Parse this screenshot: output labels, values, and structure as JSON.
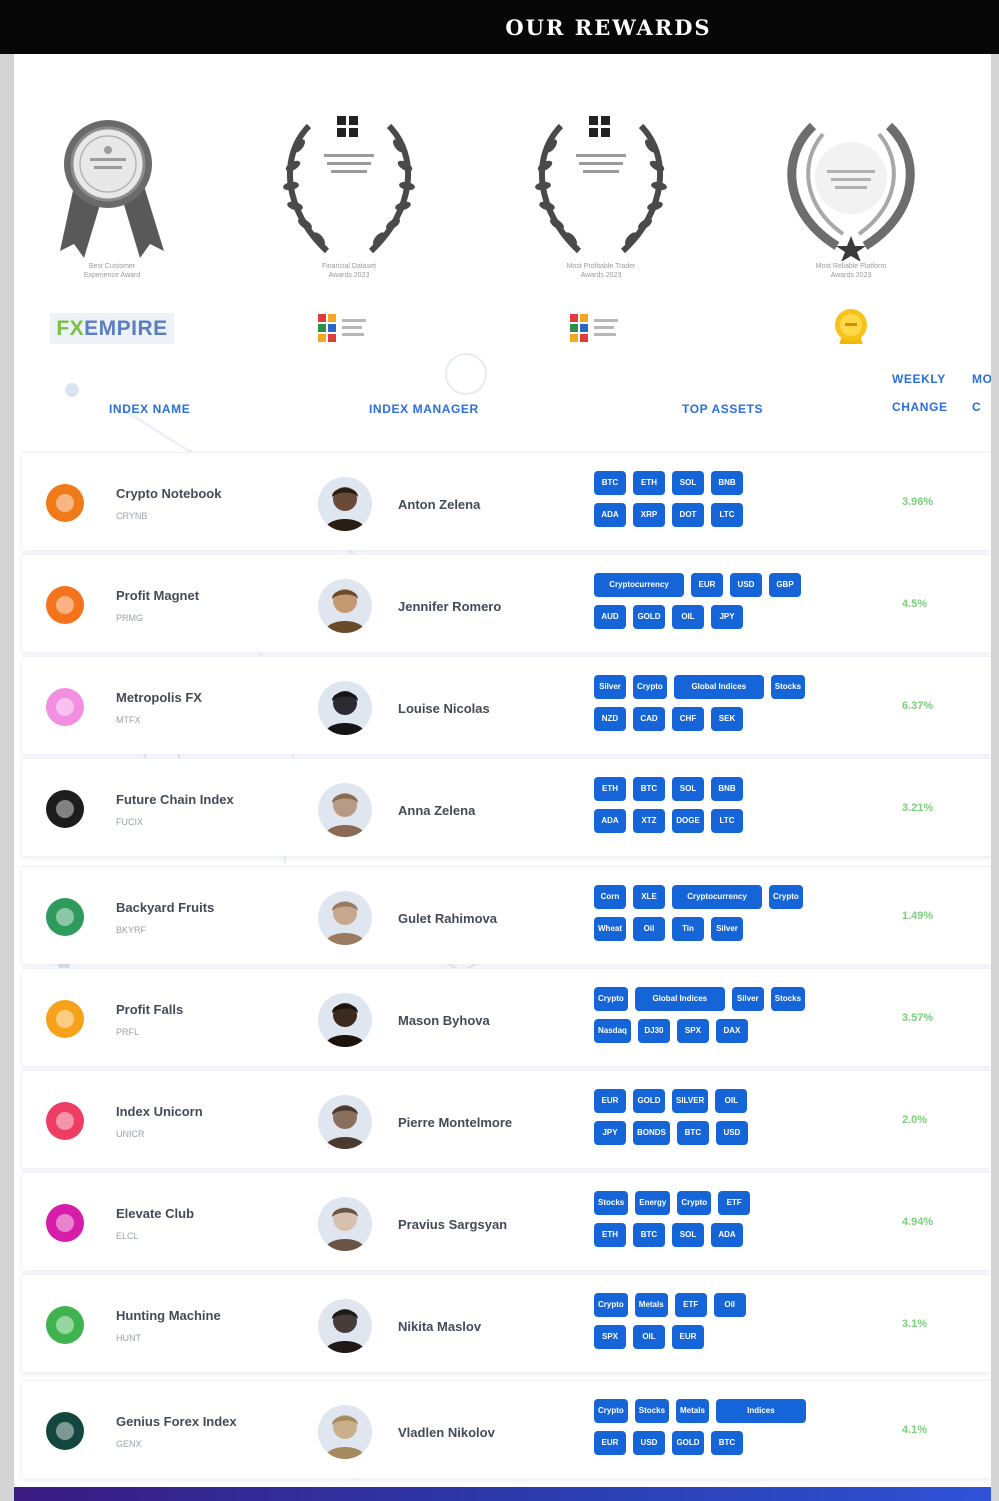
{
  "header": {
    "title": "OUR REWARDS"
  },
  "awards": [
    {
      "name": "award-ribbon",
      "caption": [
        "Best Customer",
        "Experience Award"
      ],
      "brand": {
        "kind": "fx",
        "prefix": "FX",
        "rest": "EMPIRE"
      }
    },
    {
      "name": "award-laurel-1",
      "caption": [
        "Financial Dataset",
        "Awards 2023"
      ],
      "brand": {
        "kind": "blocks"
      }
    },
    {
      "name": "award-laurel-2",
      "caption": [
        "Most Profitable Trader",
        "Awards 2023"
      ],
      "brand": {
        "kind": "blocks"
      }
    },
    {
      "name": "award-laurel-3",
      "caption": [
        "Most Reliable Platform",
        "Awards 2023"
      ],
      "brand": {
        "kind": "medal"
      }
    }
  ],
  "table": {
    "headers": {
      "index_name": "INDEX NAME",
      "index_manager": "INDEX MANAGER",
      "top_assets": "TOP ASSETS",
      "weekly_change": [
        "WEEKLY",
        "CHANGE"
      ],
      "monthly_change": [
        "MO",
        "C"
      ]
    },
    "rows": [
      {
        "name": "Crypto Notebook",
        "ticker": "CRYNB",
        "manager": "Anton Zelena",
        "assets": [
          [
            "BTC",
            "ETH",
            "SOL",
            "BNB"
          ],
          [
            "ADA",
            "XRP",
            "DOT",
            "LTC"
          ]
        ],
        "change": "3.96%",
        "logo_color": "#f07a1a",
        "avatar": {
          "bg": "#6a4a38",
          "hair": "#2a1d14"
        }
      },
      {
        "name": "Profit Magnet",
        "ticker": "PRMG",
        "manager": "Jennifer Romero",
        "assets": [
          [
            "Cryptocurrency",
            "EUR",
            "USD",
            "GBP"
          ],
          [
            "AUD",
            "GOLD",
            "OIL",
            "JPY"
          ]
        ],
        "change": "4.5%",
        "logo_color": "#f4731c",
        "avatar": {
          "bg": "#c49a72",
          "hair": "#6b4a2c"
        }
      },
      {
        "name": "Metropolis FX",
        "ticker": "MTFX",
        "manager": "Louise Nicolas",
        "assets": [
          [
            "Silver",
            "Crypto",
            "Global Indices",
            "Stocks"
          ],
          [
            "NZD",
            "CAD",
            "CHF",
            "SEK"
          ]
        ],
        "change": "6.37%",
        "logo_color": "#f28fe0",
        "avatar": {
          "bg": "#2a2a30",
          "hair": "#151518"
        }
      },
      {
        "name": "Future Chain Index",
        "ticker": "FUCIX",
        "manager": "Anna Zelena",
        "assets": [
          [
            "ETH",
            "BTC",
            "SOL",
            "BNB"
          ],
          [
            "ADA",
            "XTZ",
            "DOGE",
            "LTC"
          ]
        ],
        "change": "3.21%",
        "logo_color": "#1d1d1d",
        "avatar": {
          "bg": "#b99a86",
          "hair": "#8a6a52"
        }
      },
      {
        "name": "Backyard Fruits",
        "ticker": "BKYRF",
        "manager": "Gulet Rahimova",
        "assets": [
          [
            "Corn",
            "XLE",
            "Cryptocurrency",
            "Crypto"
          ],
          [
            "Wheat",
            "Oil",
            "Tin",
            "Silver"
          ]
        ],
        "change": "1.49%",
        "logo_color": "#2e9a5c",
        "avatar": {
          "bg": "#c7a88e",
          "hair": "#9a7a60"
        }
      },
      {
        "name": "Profit Falls",
        "ticker": "PRFL",
        "manager": "Mason Byhova",
        "assets": [
          [
            "Crypto",
            "Global Indices",
            "Silver",
            "Stocks"
          ],
          [
            "Nasdaq",
            "DJ30",
            "SPX",
            "DAX"
          ]
        ],
        "change": "3.57%",
        "logo_color": "#f7a21a",
        "avatar": {
          "bg": "#3a2a22",
          "hair": "#1c130e"
        }
      },
      {
        "name": "Index Unicorn",
        "ticker": "UNICR",
        "manager": "Pierre Montelmore",
        "assets": [
          [
            "EUR",
            "GOLD",
            "SILVER",
            "OIL"
          ],
          [
            "JPY",
            "BONDS",
            "BTC",
            "USD"
          ]
        ],
        "change": "2.0%",
        "logo_color": "#ee3d63",
        "avatar": {
          "bg": "#8a6e5e",
          "hair": "#4a3a30"
        }
      },
      {
        "name": "Elevate Club",
        "ticker": "ELCL",
        "manager": "Pravius Sargsyan",
        "assets": [
          [
            "Stocks",
            "Energy",
            "Crypto",
            "ETF"
          ],
          [
            "ETH",
            "BTC",
            "SOL",
            "ADA"
          ]
        ],
        "change": "4.94%",
        "logo_color": "#d61ca8",
        "avatar": {
          "bg": "#d7c2b0",
          "hair": "#6a5444"
        }
      },
      {
        "name": "Hunting Machine",
        "ticker": "HUNT",
        "manager": "Nikita Maslov",
        "assets": [
          [
            "Crypto",
            "Metals",
            "ETF",
            "Oil"
          ],
          [
            "SPX",
            "OIL",
            "EUR"
          ]
        ],
        "change": "3.1%",
        "logo_color": "#3fb34f",
        "avatar": {
          "bg": "#463c38",
          "hair": "#1f1a18"
        }
      },
      {
        "name": "Genius Forex Index",
        "ticker": "GENX",
        "manager": "Vladlen Nikolov",
        "assets": [
          [
            "Crypto",
            "Stocks",
            "Metals",
            "Indices"
          ],
          [
            "EUR",
            "USD",
            "GOLD",
            "BTC"
          ]
        ],
        "change": "4.1%",
        "logo_color": "#13463f",
        "avatar": {
          "bg": "#c9b08a",
          "hair": "#a78a5e"
        }
      }
    ]
  }
}
